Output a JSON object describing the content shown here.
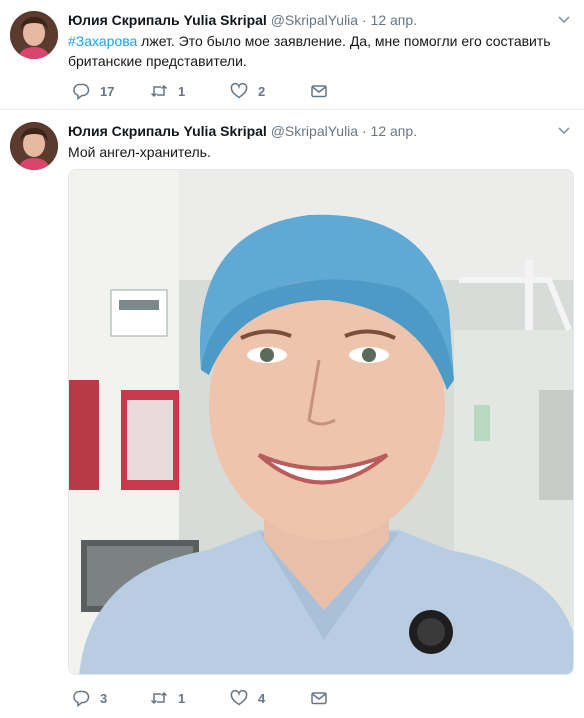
{
  "tweets": [
    {
      "fullname": "Юлия Скрипаль Yulia Skripal",
      "username": "@SkripalYulia",
      "separator": "·",
      "time": "12 апр.",
      "hashtag": "#Захарова",
      "text": " лжет. Это было мое заявление. Да, мне помогли его составить британские представители.",
      "replies": "17",
      "retweets": "1",
      "likes": "2"
    },
    {
      "fullname": "Юлия Скрипаль Yulia Skripal",
      "username": "@SkripalYulia",
      "separator": "·",
      "time": "12 апр.",
      "text": "Мой ангел-хранитель.",
      "replies": "3",
      "retweets": "1",
      "likes": "4"
    }
  ],
  "icons": {
    "reply": "reply-icon",
    "retweet": "retweet-icon",
    "like": "heart-icon",
    "dm": "envelope-icon",
    "caret": "chevron-down-icon"
  },
  "colors": {
    "link": "#1da1f2",
    "muted": "#657786",
    "text": "#14171a"
  }
}
